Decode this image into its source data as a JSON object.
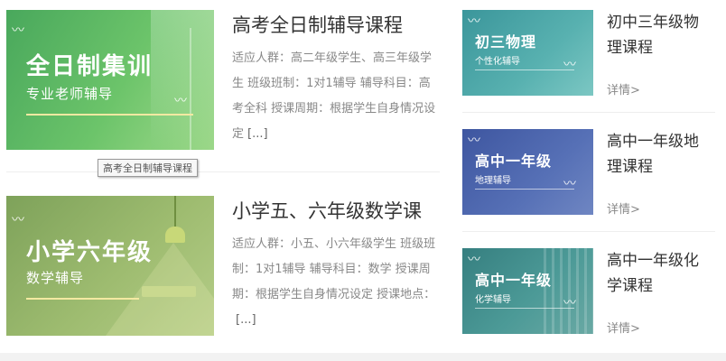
{
  "featured": [
    {
      "thumb_title": "全日制集训",
      "thumb_subtitle": "专业老师辅导",
      "title": "高考全日制辅导课程",
      "description": "适应人群：高二年级学生、高三年级学生 班级班制：1对1辅导 辅导科目：高考全科 授课周期：根据学生自身情况设定",
      "more": "[...]",
      "color": "#5cb85c"
    },
    {
      "thumb_title": "小学六年级",
      "thumb_subtitle": "数学辅导",
      "title": "小学五、六年级数学课",
      "description": "适应人群：小五、小六年级学生 班级班制：1对1辅导 辅导科目：数学 授课周期：根据学生自身情况设定 授课地点：",
      "more": "[...]",
      "color": "#96b266"
    }
  ],
  "tooltip": "高考全日制辅导课程",
  "sidebar": [
    {
      "thumb_title": "初三物理",
      "thumb_subtitle": "个性化辅导",
      "title": "初中三年级物理课程",
      "more": "详情>",
      "color": "#3f9ea3"
    },
    {
      "thumb_title": "高中一年级",
      "thumb_subtitle": "地理辅导",
      "title": "高中一年级地理课程",
      "more": "详情>",
      "color": "#4a62a8"
    },
    {
      "thumb_title": "高中一年级",
      "thumb_subtitle": "化学辅导",
      "title": "高中一年级化学课程",
      "more": "详情>",
      "color": "#3f8f8e"
    }
  ]
}
